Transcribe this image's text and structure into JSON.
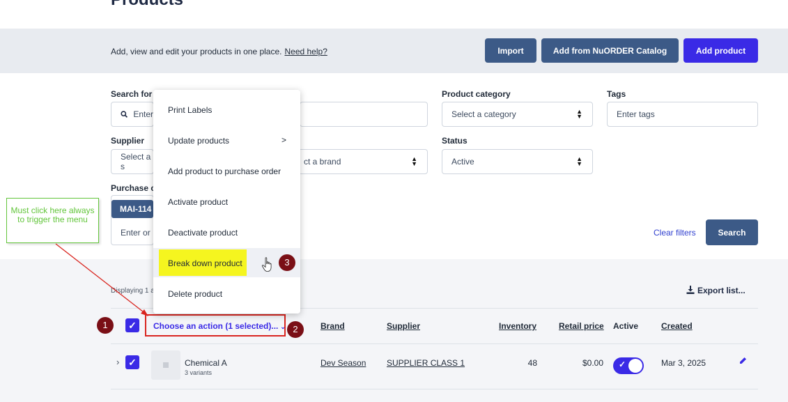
{
  "page": {
    "title": "Products"
  },
  "banner": {
    "text": "Add, view and edit your products in one place.",
    "help_link": "Need help?"
  },
  "buttons": {
    "import": "Import",
    "catalog": "Add from NuORDER Catalog",
    "add_product": "Add product"
  },
  "filters": {
    "search_label": "Search for",
    "search_placeholder": "Enter",
    "category_label": "Product category",
    "category_value": "Select a category",
    "tags_label": "Tags",
    "tags_placeholder": "Enter tags",
    "supplier_label": "Supplier",
    "supplier_value": "Select a s",
    "brand_value": "ct a brand",
    "status_label": "Status",
    "status_value": "Active",
    "purchase_label": "Purchase o",
    "purchase_chip": "MAI-114",
    "purchase_placeholder": "Enter or",
    "clear_filters": "Clear filters",
    "search_button": "Search"
  },
  "list": {
    "displaying": "Displaying 1 a",
    "export": "Export list...",
    "action_select": "Choose an action (1 selected)...",
    "columns": {
      "brand": "Brand",
      "supplier": "Supplier",
      "inventory": "Inventory",
      "retail_price": "Retail price",
      "active": "Active",
      "created": "Created"
    },
    "rows": [
      {
        "name": "Chemical A",
        "variants": "3 variants",
        "brand": "Dev Season",
        "supplier": "SUPPLIER CLASS 1",
        "inventory": "48",
        "retail_price": "$0.00",
        "active": true,
        "created": "Mar 3, 2025"
      }
    ]
  },
  "menu": {
    "items": [
      "Print Labels",
      "Update products",
      "Add product to purchase order",
      "Activate product",
      "Deactivate product",
      "Break down product",
      "Delete product"
    ],
    "submenu_indicator": ">"
  },
  "annotations": {
    "callout": "Must click here always to trigger the menu",
    "badges": [
      "1",
      "2",
      "3"
    ],
    "accent_red": "#d9251f",
    "highlight_yellow": "#f5f51f",
    "callout_green": "#62c53a"
  }
}
